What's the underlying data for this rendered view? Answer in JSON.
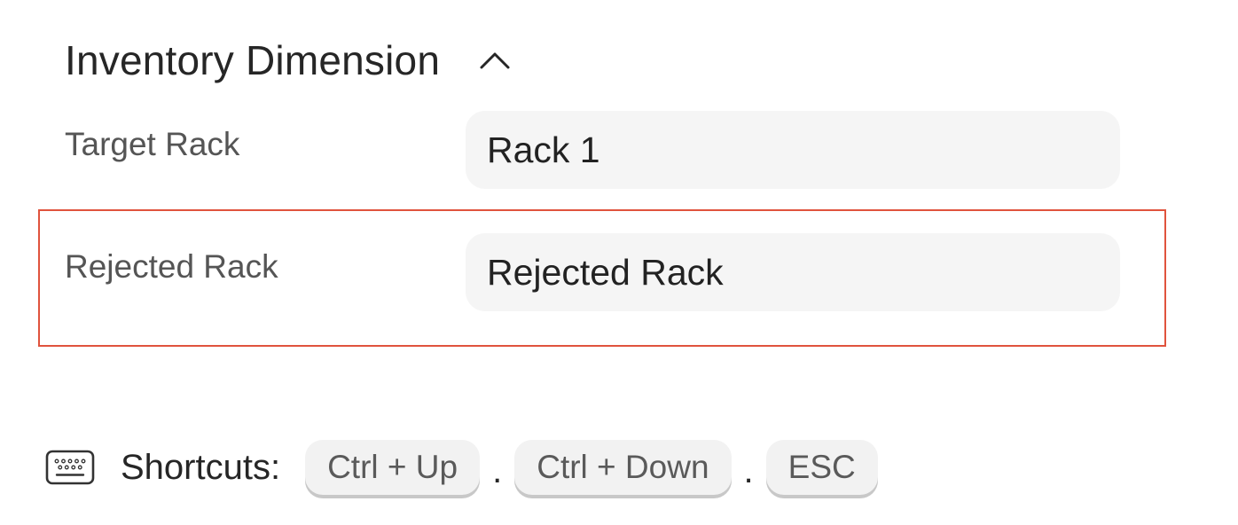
{
  "section": {
    "title": "Inventory Dimension",
    "chevron_icon": "chevron-up-icon"
  },
  "fields": [
    {
      "label": "Target Rack",
      "value": "Rack 1"
    },
    {
      "label": "Rejected Rack",
      "value": "Rejected Rack"
    }
  ],
  "highlight_color": "#e0533d",
  "shortcuts": {
    "icon": "keyboard-icon",
    "label": "Shortcuts:",
    "separator": ".",
    "keys": [
      "Ctrl + Up",
      "Ctrl + Down",
      "ESC"
    ]
  }
}
